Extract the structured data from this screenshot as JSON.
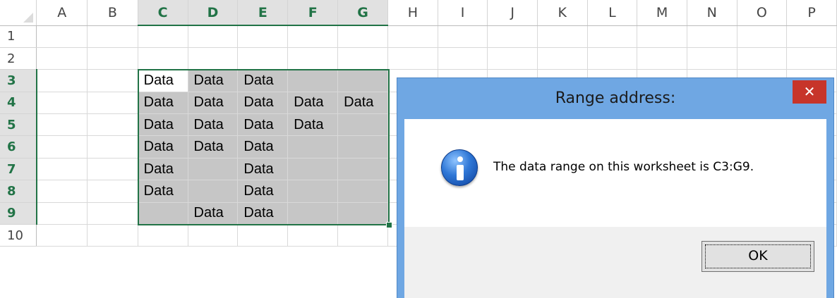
{
  "sheet": {
    "columns": [
      "A",
      "B",
      "C",
      "D",
      "E",
      "F",
      "G",
      "H",
      "I",
      "J",
      "K",
      "L",
      "M",
      "N",
      "O",
      "P"
    ],
    "selected_columns": [
      "C",
      "D",
      "E",
      "F",
      "G"
    ],
    "rows": [
      "1",
      "2",
      "3",
      "4",
      "5",
      "6",
      "7",
      "8",
      "9",
      "10"
    ],
    "selected_rows": [
      "3",
      "4",
      "5",
      "6",
      "7",
      "8",
      "9"
    ],
    "cells": {
      "C3": "Data",
      "D3": "Data",
      "E3": "Data",
      "C4": "Data",
      "D4": "Data",
      "E4": "Data",
      "F4": "Data",
      "G4": "Data",
      "C5": "Data",
      "D5": "Data",
      "E5": "Data",
      "F5": "Data",
      "C6": "Data",
      "D6": "Data",
      "E6": "Data",
      "C7": "Data",
      "E7": "Data",
      "C8": "Data",
      "E8": "Data",
      "D9": "Data",
      "E9": "Data"
    },
    "selection_range": "C3:G9",
    "active_cell": "C3",
    "colors": {
      "accent": "#217346",
      "selection_fill": "#c6c6c6",
      "header_selected": "#e1e1e1"
    }
  },
  "dialog": {
    "title": "Range address:",
    "close_label": "✕",
    "message": "The data range on this worksheet is C3:G9.",
    "icon": "info-icon",
    "ok_label": "OK",
    "colors": {
      "frame": "#6fa7e3",
      "close": "#c7352a"
    }
  }
}
